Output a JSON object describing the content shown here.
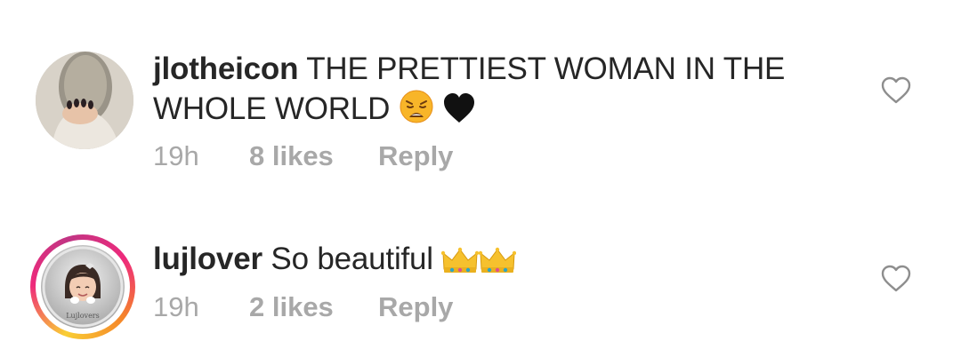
{
  "comments": [
    {
      "username": "jlotheicon",
      "text_line1": "THE PRETTIEST WOMAN IN THE",
      "text_line2": "WHOLE WORLD",
      "emojis": [
        "weary-face-icon",
        "black-heart-icon"
      ],
      "time": "19h",
      "likes": "8 likes",
      "reply": "Reply"
    },
    {
      "username": "lujlover",
      "text": "So beautiful",
      "emojis": [
        "crown-icon",
        "crown-icon"
      ],
      "avatar_text": "Lujlovers",
      "time": "19h",
      "likes": "2 likes",
      "reply": "Reply"
    }
  ],
  "colors": {
    "text": "#262626",
    "meta": "#a8a8a8",
    "heart_outline": "#8e8e8e"
  }
}
